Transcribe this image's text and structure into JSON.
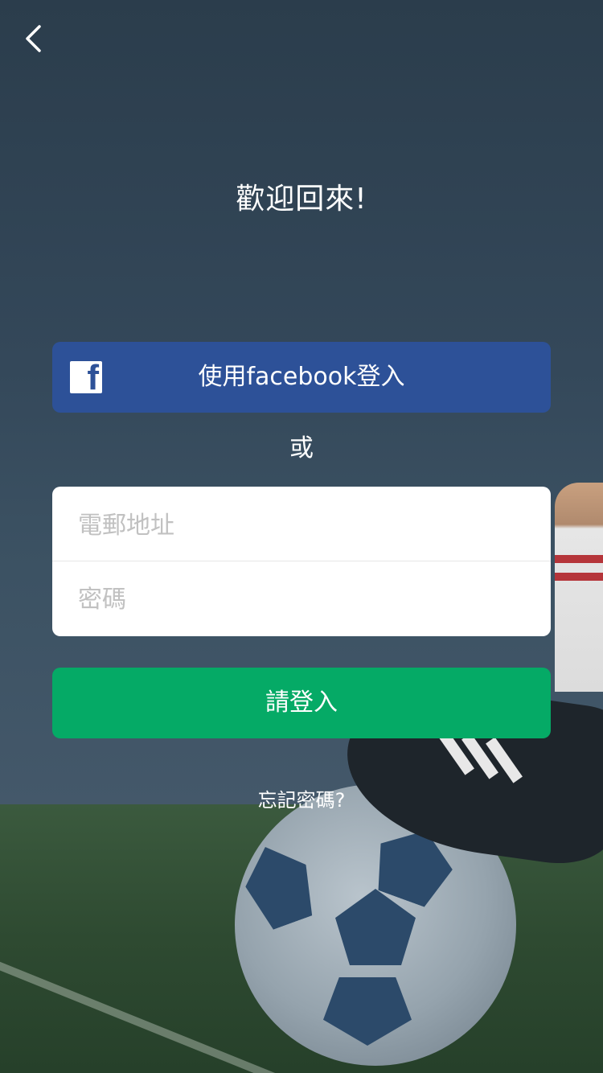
{
  "header": {
    "back_icon": "chevron-left-icon"
  },
  "welcome": {
    "title": "歡迎回來!"
  },
  "facebook": {
    "label": "使用facebook登入",
    "icon": "facebook-icon",
    "icon_glyph": "f",
    "color": "#2D5198"
  },
  "divider_text": "或",
  "form": {
    "email_placeholder": "電郵地址",
    "password_placeholder": "密碼",
    "placeholder_color": "#c1c1c1"
  },
  "login": {
    "label": "請登入",
    "color": "#05aa66"
  },
  "forgot": {
    "label": "忘記密碼?"
  }
}
